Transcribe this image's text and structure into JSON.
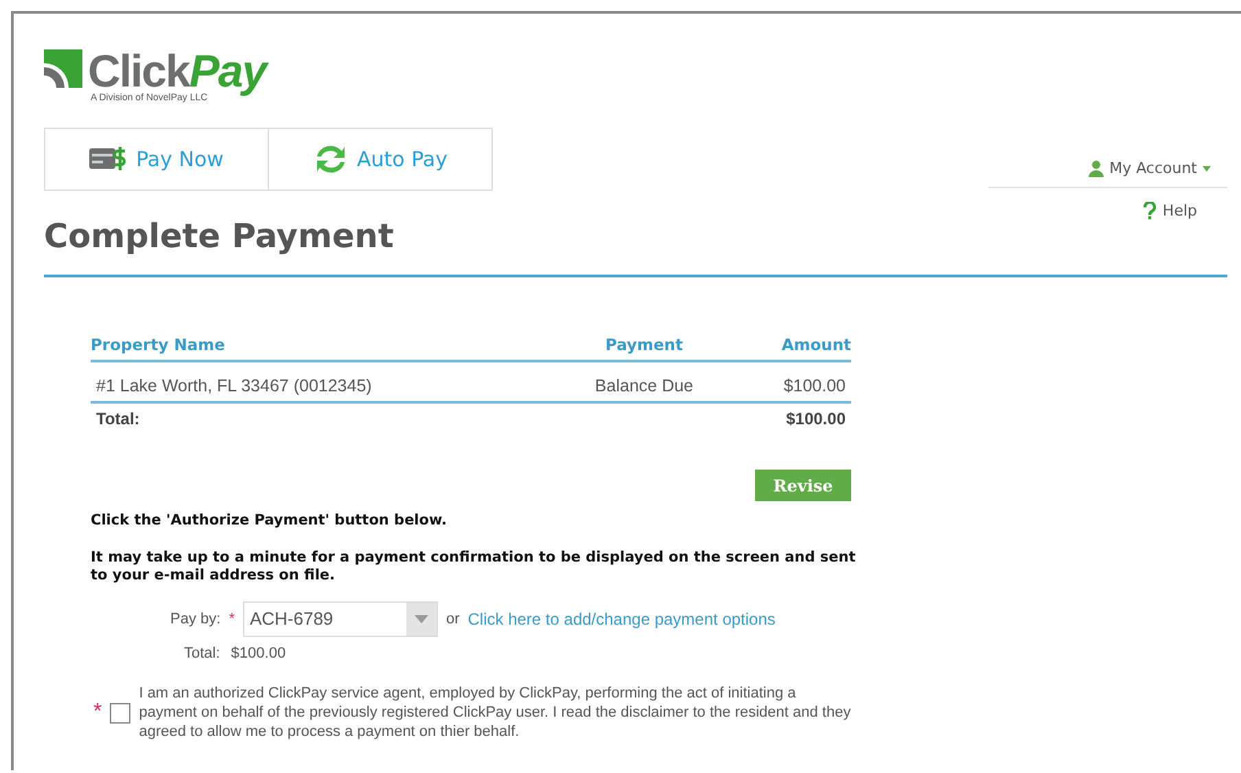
{
  "logo": {
    "brand_prefix": "Click",
    "brand_suffix": "Pay",
    "tagline": "A Division of NovelPay LLC"
  },
  "tabs": [
    {
      "label": "Pay Now",
      "kind": "card"
    },
    {
      "label": "Auto Pay",
      "kind": "refresh"
    }
  ],
  "account_menu": {
    "label": "My Account"
  },
  "help_link": "Help",
  "title": "Complete Payment",
  "table": {
    "columns": [
      "Property Name",
      "Payment",
      "Amount"
    ],
    "rows": [
      {
        "property": "#1 Lake Worth, FL 33467 (0012345)",
        "payment": "Balance Due",
        "amount": "$100.00"
      }
    ],
    "total_label": "Total:",
    "total_amount": "$100.00"
  },
  "revise_button": "Revise",
  "instructions": [
    "Click the 'Authorize Payment' button below.",
    "It may take up to a minute for a payment confirmation to be displayed on the screen and sent to your e-mail address on file."
  ],
  "pay_by": {
    "label": "Pay by:",
    "required_mark": "*",
    "value": "ACH-6789",
    "or": "or",
    "link": "Click here to add/change payment options",
    "total_label": "Total:",
    "total_value": "$100.00"
  },
  "agreement": {
    "required_mark": "*",
    "checked": false,
    "text": "I am an authorized ClickPay service agent, employed by ClickPay, performing the act of initiating a payment on behalf of the previously registered ClickPay user. I read the disclaimer to the resident and they agreed to allow me to process a payment on thier behalf."
  }
}
